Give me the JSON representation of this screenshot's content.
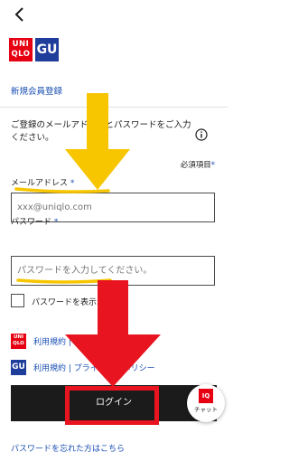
{
  "header": {
    "back_icon": "chevron-left-icon",
    "brand_uq_line1": "UNI",
    "brand_uq_line2": "QLO",
    "brand_gu": "GU"
  },
  "register_link": "新規会員登録",
  "intro_text": "ご登録のメールアドレスとパスワードをご入力ください。",
  "required_note": "必須項目",
  "required_mark": "*",
  "email": {
    "label": "メールアドレス",
    "placeholder": "xxx@uniqlo.com"
  },
  "password": {
    "label": "パスワード",
    "placeholder": "パスワードを入力してください。"
  },
  "show_password_label": "パスワードを表示",
  "terms": [
    {
      "brand": "uniqlo",
      "text": "利用規約 | プライバシーポリシー"
    },
    {
      "brand": "gu",
      "text": "利用規約 | プライバシーポリシー"
    }
  ],
  "login_button": "ログイン",
  "forgot_password": "パスワードを忘れた方はこちら",
  "chat": {
    "badge": "IQ",
    "label": "チャット"
  },
  "colors": {
    "accent_link": "#1a4fb3",
    "uniqlo_red": "#e60012",
    "gu_blue": "#1f3d9b",
    "annotation_yellow": "#f7c600",
    "annotation_red": "#e8141f"
  }
}
